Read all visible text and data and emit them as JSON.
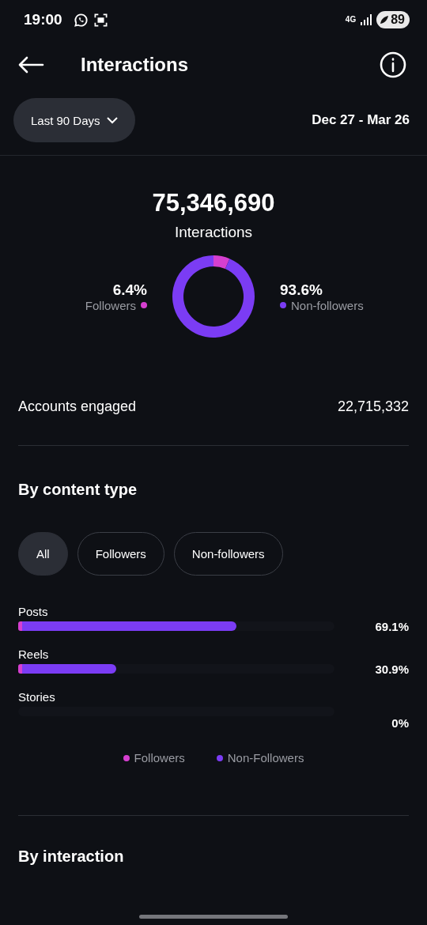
{
  "status_bar": {
    "time": "19:00",
    "network": "4G",
    "battery": "89"
  },
  "header": {
    "title": "Interactions"
  },
  "range": {
    "selector": "Last 90 Days",
    "dates": "Dec 27 - Mar 26"
  },
  "summary": {
    "total": "75,346,690",
    "chart_data": {
      "type": "donut",
      "categories": [
        "Followers",
        "Non-followers"
      ],
      "series": [
        {
          "name": "Interactions",
          "values": [
            6.4,
            93.6
          ]
        }
      ]
    },
    "legend": [
      {
        "value": "6.4%",
        "color": "#d63fd0"
      },
      {
        "value": "93.6%",
        "color": "#7b3cf4"
      }
    ]
  },
  "accounts_engaged": {
    "label": "Accounts engaged",
    "value": "22,715,332"
  },
  "by_content_type": {
    "title": "By content type",
    "filters": [
      {
        "label": "All",
        "selected": true
      },
      {
        "label": "Followers",
        "selected": false
      },
      {
        "label": "Non-followers",
        "selected": false
      }
    ],
    "rows": [
      {
        "label": "Posts",
        "value": "69.1%",
        "level": 0.691
      },
      {
        "label": "Reels",
        "value": "30.9%",
        "level": 0.309
      },
      {
        "label": "Stories",
        "value": "0%"
      }
    ],
    "legend": [
      {
        "label": "Followers",
        "color": "#d63fd0"
      },
      {
        "label": "Non-Followers",
        "color": "#7b3cf4"
      }
    ]
  },
  "by_interaction": {
    "title": "By interaction"
  }
}
